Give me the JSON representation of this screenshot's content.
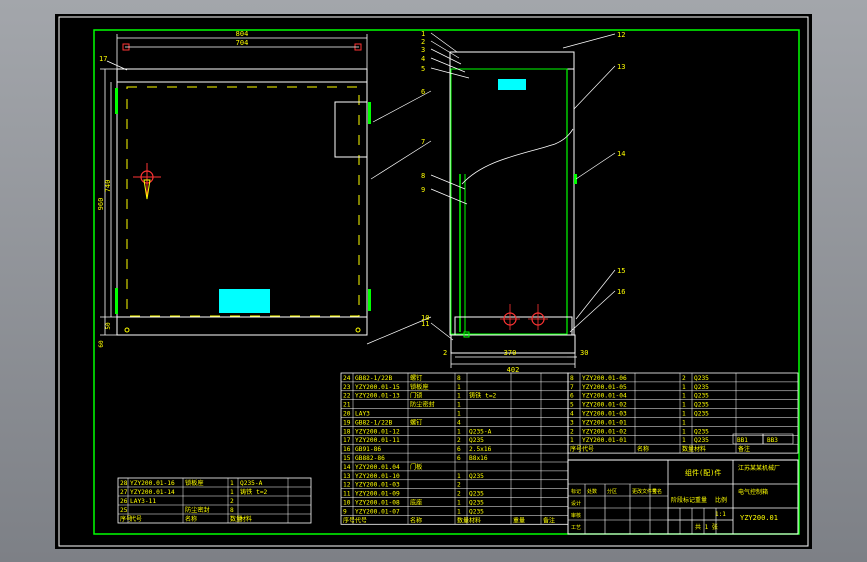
{
  "colors": {
    "frame": "#00ff00",
    "lines": "#ffffff",
    "text": "#ffff00",
    "dims": "#ffff00",
    "accent": "#00ffff",
    "marks": "#ff3333",
    "background": "#000000"
  },
  "front_view": {
    "dims": {
      "width_total": "804",
      "width_inner": "704",
      "height_total": "960",
      "height_inner": "740",
      "bottom_a": "60",
      "bottom_b": "50"
    },
    "callout_left": "17"
  },
  "side_view": {
    "dims": {
      "width_total": "402",
      "width_inner": "370",
      "offset": "30",
      "corner": "2"
    },
    "callouts": [
      "1",
      "2",
      "3",
      "4",
      "5",
      "6",
      "7",
      "8",
      "9",
      "10",
      "11",
      "12",
      "13",
      "14",
      "15",
      "16"
    ]
  },
  "bom_mid": [
    {
      "no": "24",
      "code": "GB82-1/22B",
      "name": "螺钉",
      "qty": "8",
      "material": ""
    },
    {
      "no": "23",
      "code": "YZY200.01-15",
      "name": "锁板座",
      "qty": "1",
      "material": ""
    },
    {
      "no": "22",
      "code": "YZY200.01-13",
      "name": "门锁",
      "qty": "1",
      "material": "铸铁 t=2"
    },
    {
      "no": "21",
      "code": "",
      "name": "防尘密封",
      "qty": "1",
      "material": ""
    },
    {
      "no": "20",
      "code": "LAY3",
      "name": "",
      "qty": "1",
      "material": ""
    },
    {
      "no": "19",
      "code": "GB82-1/22B",
      "name": "螺钉",
      "qty": "4",
      "material": ""
    },
    {
      "no": "18",
      "code": "YZY200.01-12",
      "name": "",
      "qty": "1",
      "material": "Q235-A"
    },
    {
      "no": "17",
      "code": "YZY200.01-11",
      "name": "",
      "qty": "2",
      "material": "Q235"
    },
    {
      "no": "16",
      "code": "GB91-86",
      "name": "",
      "qty": "6",
      "material": "2.5x16"
    },
    {
      "no": "15",
      "code": "GB882-86",
      "name": "",
      "qty": "6",
      "material": "B8x16"
    },
    {
      "no": "14",
      "code": "YZY200.01.04",
      "name": "门板",
      "qty": "",
      "material": ""
    },
    {
      "no": "13",
      "code": "YZY200.01-10",
      "name": "",
      "qty": "1",
      "material": "Q235"
    },
    {
      "no": "12",
      "code": "YZY200.01-03",
      "name": "",
      "qty": "2",
      "material": ""
    },
    {
      "no": "11",
      "code": "YZY200.01-09",
      "name": "",
      "qty": "2",
      "material": "Q235"
    },
    {
      "no": "10",
      "code": "YZY200.01-08",
      "name": "底座",
      "qty": "1",
      "material": "Q235"
    },
    {
      "no": "9",
      "code": "YZY200.01-07",
      "name": "",
      "qty": "1",
      "material": "Q235"
    }
  ],
  "bom_mid_header": {
    "no": "序号",
    "code": "代号",
    "name": "名称",
    "qty": "数量",
    "material": "材料",
    "weight": "重量",
    "remark": "备注"
  },
  "bom_right": [
    {
      "no": "8",
      "code": "YZY200.01-06",
      "name": "",
      "qty": "2",
      "material": "Q235"
    },
    {
      "no": "7",
      "code": "YZY200.01-05",
      "name": "",
      "qty": "1",
      "material": "Q235"
    },
    {
      "no": "6",
      "code": "YZY200.01-04",
      "name": "",
      "qty": "1",
      "material": "Q235"
    },
    {
      "no": "5",
      "code": "YZY200.01-02",
      "name": "",
      "qty": "1",
      "material": "Q235"
    },
    {
      "no": "4",
      "code": "YZY200.01-03",
      "name": "",
      "qty": "1",
      "material": "Q235"
    },
    {
      "no": "3",
      "code": "YZY200.01-01",
      "name": "",
      "qty": "1",
      "material": ""
    },
    {
      "no": "2",
      "code": "YZY200.01-02",
      "name": "",
      "qty": "1",
      "material": "Q235"
    },
    {
      "no": "1",
      "code": "YZY200.01-01",
      "name": "",
      "qty": "1",
      "material": "Q235"
    }
  ],
  "bom_right_header": {
    "no": "序号",
    "code": "代号",
    "name": "名称",
    "qty": "数量",
    "material": "材料",
    "remark": "备注"
  },
  "bom_left": [
    {
      "no": "28",
      "code": "YZY200.01-16",
      "name": "锁板座",
      "qty": "1",
      "material": "Q235-A"
    },
    {
      "no": "27",
      "code": "YZY200.01-14",
      "name": "",
      "qty": "1",
      "material": "铸铁 t=2"
    },
    {
      "no": "26",
      "code": "LAY3-11",
      "name": "",
      "qty": "2",
      "material": ""
    },
    {
      "no": "25",
      "code": "",
      "name": "防尘密封",
      "qty": "8",
      "material": ""
    }
  ],
  "bom_left_header": {
    "no": "序号",
    "code": "代号",
    "name": "名称",
    "qty": "数量",
    "material": "材料"
  },
  "title_block": {
    "title": "组件(配)件",
    "company": "江苏某某机械厂",
    "part_name": "电气控制箱",
    "drawing_no": "YZY200.01",
    "scale_label": "比例",
    "scale": "1:1",
    "weight_label": "重量",
    "sheet": "共 1 张",
    "signatures": [
      "标记",
      "处数",
      "分区",
      "更改文件号",
      "签名",
      "年 月 日"
    ],
    "roles": [
      "设计",
      "审核",
      "工艺",
      "批准"
    ],
    "stage": "阶段标记",
    "mass": "重量",
    "ratio": "比例"
  },
  "small_boxes": [
    "BB1",
    "BB3"
  ]
}
